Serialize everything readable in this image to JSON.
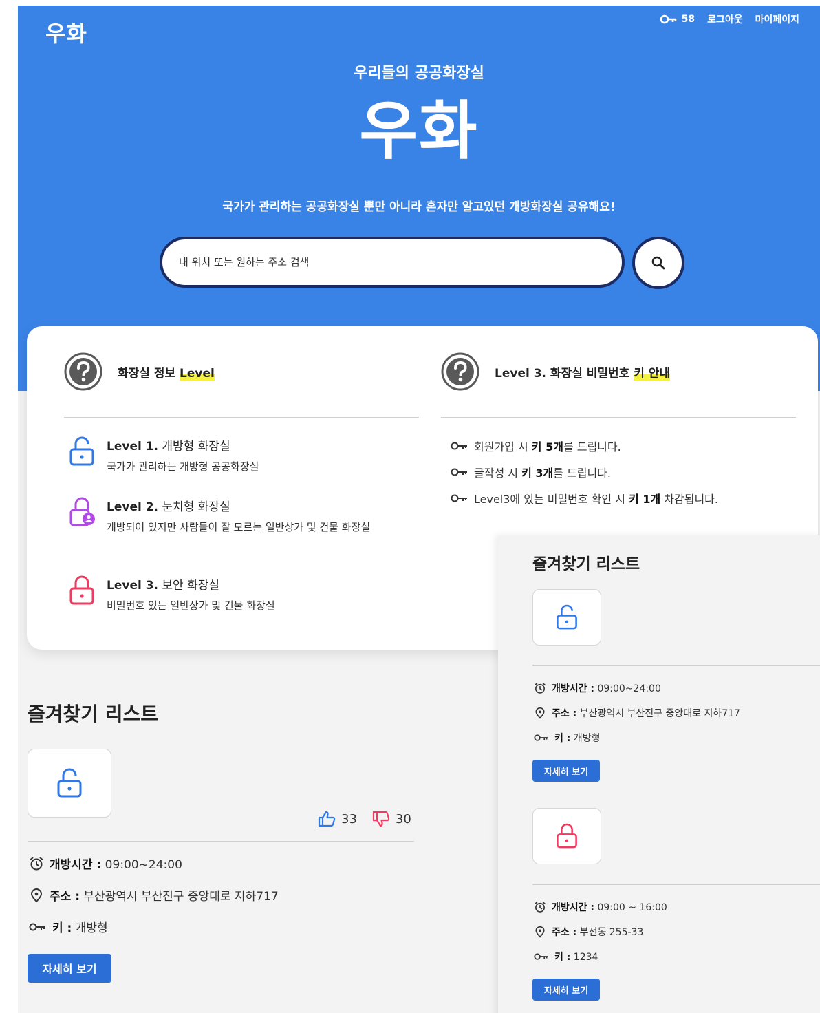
{
  "header": {
    "logo": "우화",
    "key_count": "58",
    "logout": "로그아웃",
    "mypage": "마이페이지"
  },
  "hero": {
    "subtitle": "우리들의 공공화장실",
    "title": "우화",
    "tagline": "국가가 관리하는 공공화장실 뿐만 아니라 혼자만 알고있던 개방화장실 공유해요!"
  },
  "search": {
    "placeholder": "내 위치 또는 원하는 주소 검색"
  },
  "info": {
    "level_heading_prefix": "화장실 정보 ",
    "level_heading_highlight": "Level",
    "key_heading_prefix": "Level 3. 화장실 비밀번호 ",
    "key_heading_highlight": "키 안내",
    "levels": [
      {
        "label": "Level 1.",
        "name": " 개방형 화장실",
        "desc": "국가가 관리하는 개방형 공공화장실",
        "color": "#2f78e8"
      },
      {
        "label": "Level 2.",
        "name": " 눈치형 화장실",
        "desc": "개방되어 있지만 사람들이 잘 모르는 일반상가 및 건물 화장실",
        "color": "#b24be6"
      },
      {
        "label": "Level 3.",
        "name": " 보안 화장실",
        "desc": "비밀번호 있는 일반상가 및 건물 화장실",
        "color": "#f03a5f"
      }
    ],
    "key_lines": [
      {
        "pre": "회원가입 시 ",
        "bold": "키 5개",
        "post": "를 드립니다."
      },
      {
        "pre": "글작성 시 ",
        "bold": "키 3개",
        "post": "를 드립니다."
      },
      {
        "pre": "Level3에 있는 비밀번호 확인 시 ",
        "bold": "키 1개",
        "post": " 차감됩니다."
      }
    ]
  },
  "favorites_left": {
    "title": "즐겨찾기 리스트",
    "likes": "33",
    "dislikes": "30",
    "hours_label": "개방시간 :",
    "hours": " 09:00~24:00",
    "addr_label": "주소 :",
    "addr": " 부산광역시 부산진구 중앙대로 지하717",
    "key_label": "키 :",
    "key": " 개방형",
    "detail_button": "자세히 보기"
  },
  "favorites_panel": {
    "title": "즐겨찾기 리스트",
    "items": [
      {
        "hours_label": "개방시간 :",
        "hours": " 09:00~24:00",
        "addr_label": "주소 :",
        "addr": " 부산광역시 부산진구 중앙대로 지하717",
        "key_label": "키 :",
        "key": " 개방형",
        "detail_button": "자세히 보기"
      },
      {
        "hours_label": "개방시간 :",
        "hours": " 09:00 ~ 16:00",
        "addr_label": "주소 :",
        "addr": " 부전동 255-33",
        "key_label": "키 :",
        "key": " 1234",
        "detail_button": "자세히 보기"
      }
    ]
  },
  "colors": {
    "brand_blue": "#3a83e6",
    "button_blue": "#2b6fd6",
    "level1": "#2f78e8",
    "level2": "#b24be6",
    "level3": "#f03a5f",
    "highlight": "#f4f142"
  }
}
